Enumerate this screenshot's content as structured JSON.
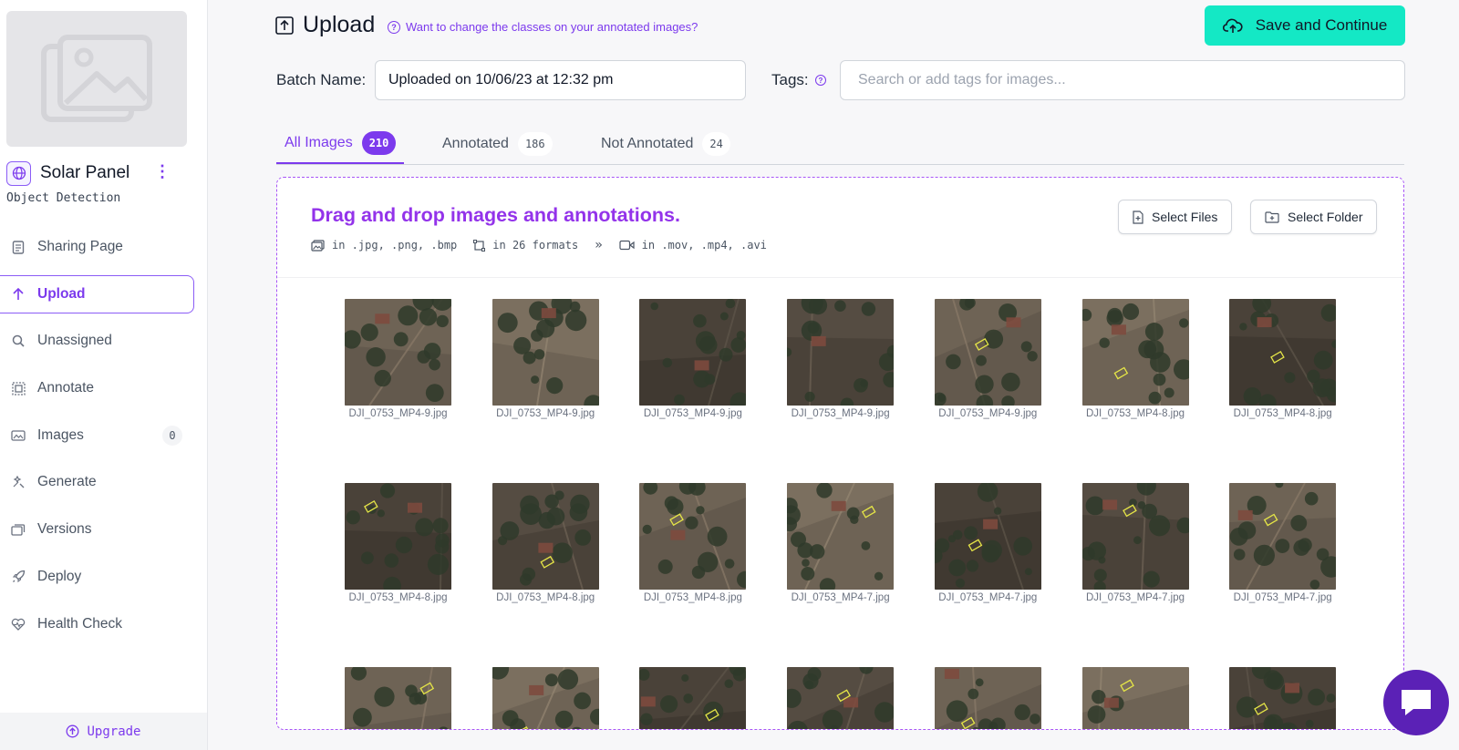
{
  "sidebar": {
    "project_name": "Solar Panel",
    "project_type": "Object Detection",
    "items": [
      {
        "label": "Sharing Page",
        "icon": "document-icon"
      },
      {
        "label": "Upload",
        "icon": "arrow-up-icon",
        "active": true
      },
      {
        "label": "Unassigned",
        "icon": "search-icon"
      },
      {
        "label": "Annotate",
        "icon": "annotate-icon"
      },
      {
        "label": "Images",
        "icon": "images-icon",
        "count": "0"
      },
      {
        "label": "Generate",
        "icon": "generate-icon"
      },
      {
        "label": "Versions",
        "icon": "versions-icon"
      },
      {
        "label": "Deploy",
        "icon": "rocket-icon"
      },
      {
        "label": "Health Check",
        "icon": "heart-pulse-icon"
      }
    ],
    "upgrade_label": "Upgrade"
  },
  "header": {
    "title": "Upload",
    "help_link": "Want to change the classes on your annotated images?",
    "save_label": "Save and Continue"
  },
  "form": {
    "batch_label": "Batch Name:",
    "batch_value": "Uploaded on 10/06/23 at 12:32 pm",
    "tags_label": "Tags:",
    "tags_placeholder": "Search or add tags for images..."
  },
  "tabs": [
    {
      "label": "All Images",
      "count": "210",
      "active": true
    },
    {
      "label": "Annotated",
      "count": "186"
    },
    {
      "label": "Not Annotated",
      "count": "24"
    }
  ],
  "dropzone": {
    "title": "Drag and drop images and annotations.",
    "formats": [
      "in .jpg, .png, .bmp",
      "in 26 formats",
      "in .mov, .mp4, .avi"
    ],
    "select_files": "Select Files",
    "select_folder": "Select Folder"
  },
  "images": [
    "DJI_0753_MP4-9.jpg",
    "DJI_0753_MP4-9.jpg",
    "DJI_0753_MP4-9.jpg",
    "DJI_0753_MP4-9.jpg",
    "DJI_0753_MP4-9.jpg",
    "DJI_0753_MP4-8.jpg",
    "DJI_0753_MP4-8.jpg",
    "DJI_0753_MP4-8.jpg",
    "DJI_0753_MP4-8.jpg",
    "DJI_0753_MP4-8.jpg",
    "DJI_0753_MP4-7.jpg",
    "DJI_0753_MP4-7.jpg",
    "DJI_0753_MP4-7.jpg",
    "DJI_0753_MP4-7.jpg",
    "",
    "",
    "",
    "",
    "",
    "",
    ""
  ],
  "colors": {
    "accent": "#7c3aed",
    "save": "#14e8c5",
    "chat": "#5b21b6"
  }
}
